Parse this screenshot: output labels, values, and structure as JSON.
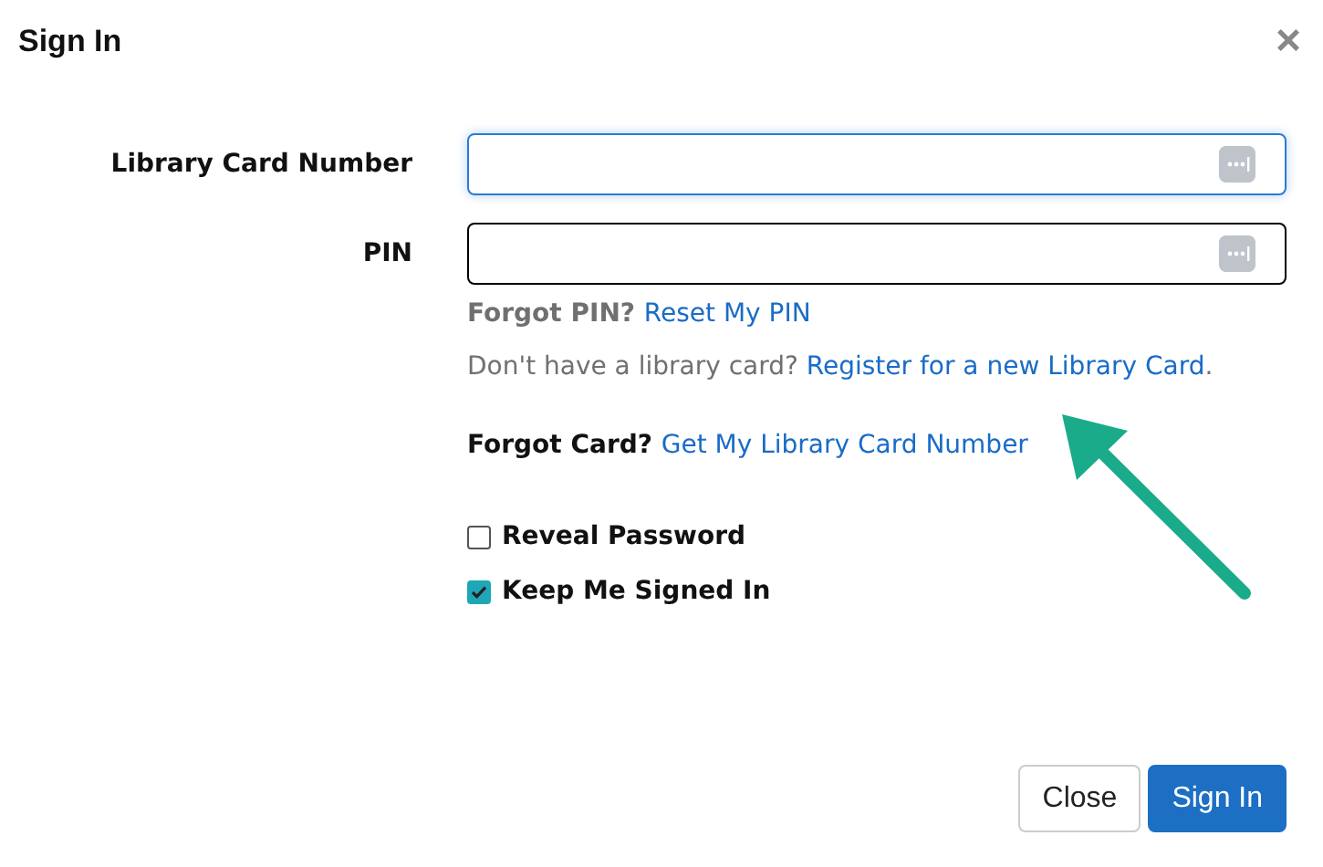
{
  "dialog": {
    "title": "Sign In",
    "close_icon": "×"
  },
  "fields": [
    {
      "label": "Library Card Number",
      "focused": true
    },
    {
      "label": "PIN",
      "focused": false
    }
  ],
  "help_lines": [
    {
      "kind": "muted-bold",
      "prefix": "Forgot PIN?",
      "link": "Reset My PIN"
    },
    {
      "kind": "muted",
      "prefix": "Don't have a library card?",
      "link": "Register for a new Library Card",
      "suffix": "."
    },
    {
      "kind": "bold",
      "prefix": "Forgot Card?",
      "link": "Get My Library Card Number"
    }
  ],
  "checkboxes": [
    {
      "label": "Reveal Password",
      "checked": false
    },
    {
      "label": "Keep Me Signed In",
      "checked": true
    }
  ],
  "buttons": [
    {
      "label": "Close",
      "kind": "secondary"
    },
    {
      "label": "Sign In",
      "kind": "primary"
    }
  ]
}
